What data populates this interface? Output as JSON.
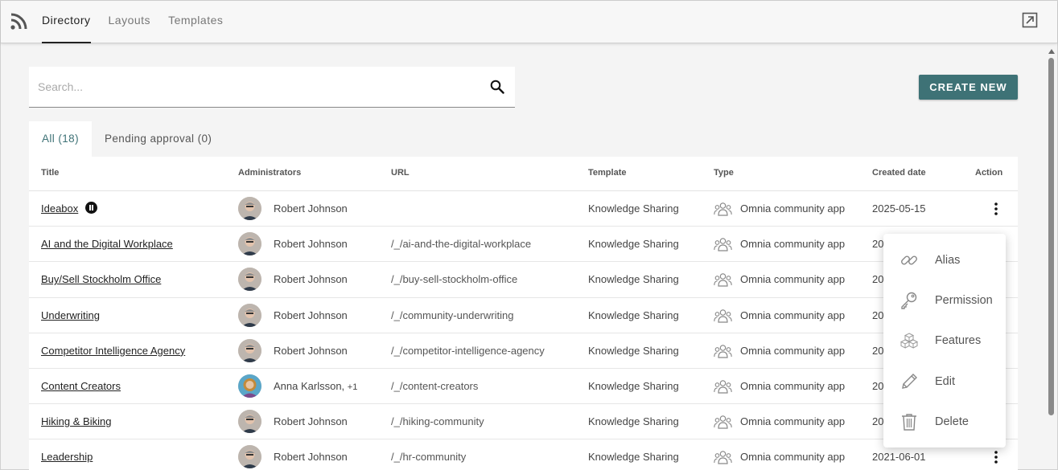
{
  "topbar": {
    "tabs": [
      {
        "label": "Directory",
        "active": true
      },
      {
        "label": "Layouts",
        "active": false
      },
      {
        "label": "Templates",
        "active": false
      }
    ],
    "icons": {
      "left": "rss-icon",
      "right": "open-external-icon"
    }
  },
  "search": {
    "placeholder": "Search...",
    "value": ""
  },
  "create_button": {
    "label": "CREATE NEW",
    "color": "#3e7276"
  },
  "filter_tabs": [
    {
      "label": "All (18)",
      "active": true
    },
    {
      "label": "Pending approval (0)",
      "active": false
    }
  ],
  "table": {
    "columns": [
      "Title",
      "Administrators",
      "URL",
      "Template",
      "Type",
      "Created date",
      "Action"
    ],
    "rows": [
      {
        "title": "Ideabox",
        "status_icon": "paused-icon",
        "admin": "Robert Johnson",
        "url": "",
        "template": "Knowledge Sharing",
        "type": "Omnia community app",
        "created": "2025-05-15"
      },
      {
        "title": "AI and the Digital Workplace",
        "admin": "Robert Johnson",
        "url": "/_/ai-and-the-digital-workplace",
        "template": "Knowledge Sharing",
        "type": "Omnia community app",
        "created": "20"
      },
      {
        "title": "Buy/Sell Stockholm Office",
        "admin": "Robert Johnson",
        "url": "/_/buy-sell-stockholm-office",
        "template": "Knowledge Sharing",
        "type": "Omnia community app",
        "created": "20"
      },
      {
        "title": "Underwriting",
        "admin": "Robert Johnson",
        "url": "/_/community-underwriting",
        "template": "Knowledge Sharing",
        "type": "Omnia community app",
        "created": "20"
      },
      {
        "title": "Competitor Intelligence Agency",
        "admin": "Robert Johnson",
        "url": "/_/competitor-intelligence-agency",
        "template": "Knowledge Sharing",
        "type": "Omnia community app",
        "created": "20"
      },
      {
        "title": "Content Creators",
        "admin": "Anna Karlsson,",
        "admin_extra": "+1",
        "url": "/_/content-creators",
        "template": "Knowledge Sharing",
        "type": "Omnia community app",
        "created": "20"
      },
      {
        "title": "Hiking & Biking",
        "admin": "Robert Johnson",
        "url": "/_/hiking-community",
        "template": "Knowledge Sharing",
        "type": "Omnia community app",
        "created": "20"
      },
      {
        "title": "Leadership",
        "admin": "Robert Johnson",
        "url": "/_/hr-community",
        "template": "Knowledge Sharing",
        "type": "Omnia community app",
        "created": "2021-06-01"
      }
    ]
  },
  "context_menu": {
    "items": [
      {
        "label": "Alias",
        "icon": "link-icon"
      },
      {
        "label": "Permission",
        "icon": "key-icon"
      },
      {
        "label": "Features",
        "icon": "cubes-icon"
      },
      {
        "label": "Edit",
        "icon": "pencil-icon"
      },
      {
        "label": "Delete",
        "icon": "trash-icon"
      }
    ]
  }
}
